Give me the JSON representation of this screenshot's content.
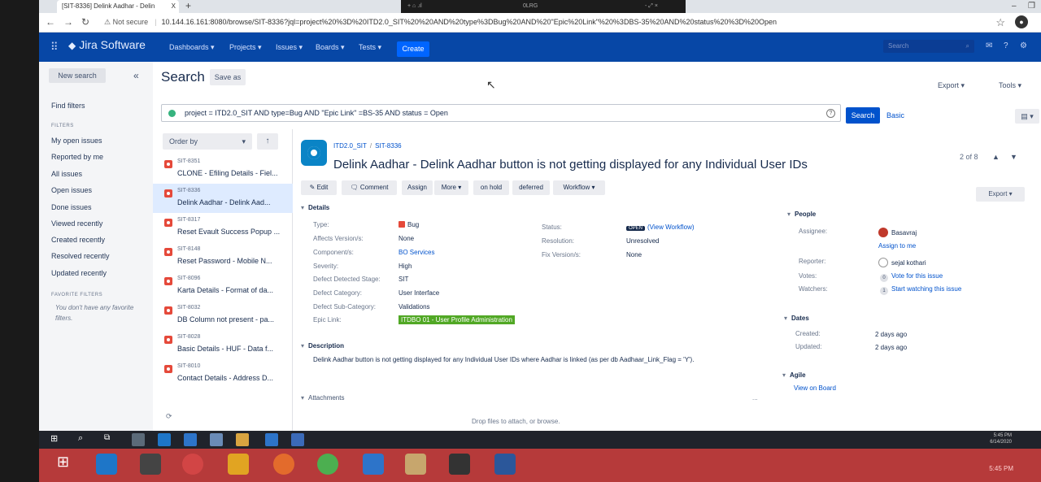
{
  "browser": {
    "tab_title": "[SIT-8336] Delink Aadhar - Delin",
    "tab_close": "X",
    "new_tab": "+",
    "url_security": "Not secure",
    "url": "10.144.16.161:8080/browse/SIT-8336?jql=project%20%3D%20ITD2.0_SIT%20%20AND%20type%3DBug%20AND%20\"Epic%20Link\"%20%3DBS-35%20AND%20status%20%3D%20Open",
    "overlay_text_left": "+ ⌂ .ıl",
    "overlay_text_mid": "0LRG",
    "overlay_text_right": "- ⤢ ×"
  },
  "jira": {
    "product": "Jira Software",
    "nav": [
      "Dashboards ▾",
      "Projects ▾",
      "Issues ▾",
      "Boards ▾",
      "Tests ▾"
    ],
    "create": "Create",
    "search_placeholder": "Search"
  },
  "sidebar": {
    "new_search": "New search",
    "collapse": "«",
    "find_filters": "Find filters",
    "filters_heading": "FILTERS",
    "filters": [
      "My open issues",
      "Reported by me",
      "All issues",
      "Open issues",
      "Done issues",
      "Viewed recently",
      "Created recently",
      "Resolved recently",
      "Updated recently"
    ],
    "favorite_heading": "FAVORITE FILTERS",
    "favorite_note": "You don't have any favorite filters."
  },
  "search": {
    "title": "Search",
    "save_as": "Save as",
    "export": "Export ▾",
    "tools": "Tools ▾",
    "jql": "project = ITD2.0_SIT  AND type=Bug AND \"Epic Link\" =BS-35 AND status = Open",
    "jql_help": "?",
    "search_button": "Search",
    "basic": "Basic",
    "view_toggle": "▤ ▾"
  },
  "list": {
    "order_by": "Order by",
    "order_chev": "▾",
    "sort_dir": "↑",
    "items": [
      {
        "key": "SIT-8351",
        "summary": "CLONE - Efiling Details - Fiel..."
      },
      {
        "key": "SIT-8336",
        "summary": "Delink Aadhar - Delink Aad..."
      },
      {
        "key": "SIT-8317",
        "summary": "Reset Evault Success Popup ..."
      },
      {
        "key": "SIT-8148",
        "summary": "Reset Password - Mobile N..."
      },
      {
        "key": "SIT-8096",
        "summary": "Karta Details - Format of da..."
      },
      {
        "key": "SIT-8032",
        "summary": "DB Column not present - pa..."
      },
      {
        "key": "SIT-8028",
        "summary": "Basic Details - HUF - Data f..."
      },
      {
        "key": "SIT-8010",
        "summary": "Contact Details - Address D..."
      }
    ],
    "refresh": "⟳"
  },
  "issue": {
    "project": "ITD2.0_SIT",
    "key": "SIT-8336",
    "title": "Delink Aadhar - Delink Aadhar button is not getting displayed for any Individual User IDs",
    "pager": "2 of 8",
    "pager_up": "▲",
    "pager_down": "▼",
    "actions": [
      "✎ Edit",
      "🗨 Comment",
      "Assign",
      "More ▾",
      "on hold",
      "deferred",
      "Workflow ▾"
    ],
    "export": "Export ▾",
    "details_heading": "Details",
    "details": [
      {
        "label": "Type:",
        "value": "Bug"
      },
      {
        "label": "Affects Version/s:",
        "value": "None"
      },
      {
        "label": "Component/s:",
        "value": "BO Services"
      },
      {
        "label": "Severity:",
        "value": "High"
      },
      {
        "label": "Defect Detected Stage:",
        "value": "SIT"
      },
      {
        "label": "Defect Category:",
        "value": "User Interface"
      },
      {
        "label": "Defect Sub-Category:",
        "value": "Validations"
      },
      {
        "label": "Epic Link:",
        "value": "ITDBO 01 - User Profile Administration"
      }
    ],
    "status_fields": [
      {
        "label": "Status:",
        "badge": "OPEN",
        "value": "(View Workflow)"
      },
      {
        "label": "Resolution:",
        "value": "Unresolved"
      },
      {
        "label": "Fix Version/s:",
        "value": "None"
      }
    ],
    "description_heading": "Description",
    "description": "Delink Aadhar button is not getting displayed for any Individual User IDs where Aadhar is linked (as per db Aadhaar_Link_Flag = 'Y').",
    "attachments_heading": "Attachments",
    "drop_files": "Drop files to attach, or browse.",
    "people_heading": "People",
    "assignee_label": "Assignee:",
    "assignee": "Basavraj",
    "assign_to_me": "Assign to me",
    "reporter_label": "Reporter:",
    "reporter": "sejal kothari",
    "votes_label": "Votes:",
    "votes_count": "0",
    "votes_link": "Vote for this issue",
    "watchers_label": "Watchers:",
    "watchers_count": "1",
    "watchers_link": "Start watching this issue",
    "dates_heading": "Dates",
    "created_label": "Created:",
    "created": "2 days ago",
    "updated_label": "Updated:",
    "updated": "2 days ago",
    "agile_heading": "Agile",
    "view_on_board": "View on Board",
    "more_dots": "..."
  },
  "taskbar": {
    "time": "5:45 PM",
    "date": "6/14/2020",
    "time2": "5:45 PM"
  }
}
